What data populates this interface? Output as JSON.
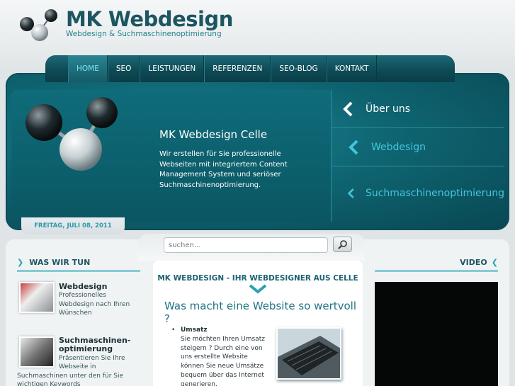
{
  "brand": {
    "title": "MK Webdesign",
    "subtitle": "Webdesign & Suchmaschinenoptimierung"
  },
  "nav": {
    "items": [
      {
        "label": "HOME",
        "active": true
      },
      {
        "label": "SEO"
      },
      {
        "label": "LEISTUNGEN"
      },
      {
        "label": "REFERENZEN"
      },
      {
        "label": "SEO-BLOG"
      },
      {
        "label": "KONTAKT"
      }
    ]
  },
  "hero": {
    "title": "MK Webdesign Celle",
    "text": "Wir erstellen für Sie professionelle Webseiten mit integriertem Content Management System und seriöser Suchmaschinenoptimierung.",
    "menu": [
      {
        "label": "Über uns"
      },
      {
        "label": "Webdesign"
      },
      {
        "label": "Suchmaschinenoptimierung"
      }
    ]
  },
  "date": "FREITAG, JULI 08, 2011",
  "search": {
    "placeholder": "suchen..."
  },
  "left": {
    "heading": "WAS WIR TUN",
    "services": [
      {
        "title": "Webdesign",
        "desc": "Professionelles Webdesign nach Ihren Wünschen"
      },
      {
        "title": "Suchmaschinen-optimierung",
        "desc_lines": [
          "Präsentieren Sie Ihre",
          "Webseite in",
          "Suchmaschinen unter den für Sie",
          "wichtigen Keywords"
        ]
      }
    ]
  },
  "center": {
    "heading": "MK WEBDESIGN - IHR WEBDESIGNER AUS CELLE",
    "subheading": "Was macht eine Website so wertvoll ?",
    "item_title": "Umsatz",
    "item_text": "Sie möchten Ihren Umsatz steigern ? Durch eine von uns erstellte Website können Sie neue Umsätze bequem über das Internet generieren."
  },
  "right": {
    "heading": "VIDEO"
  },
  "colors": {
    "accent": "#2aa0b6",
    "dark_teal": "#0d4954",
    "text_teal": "#1d6272"
  }
}
